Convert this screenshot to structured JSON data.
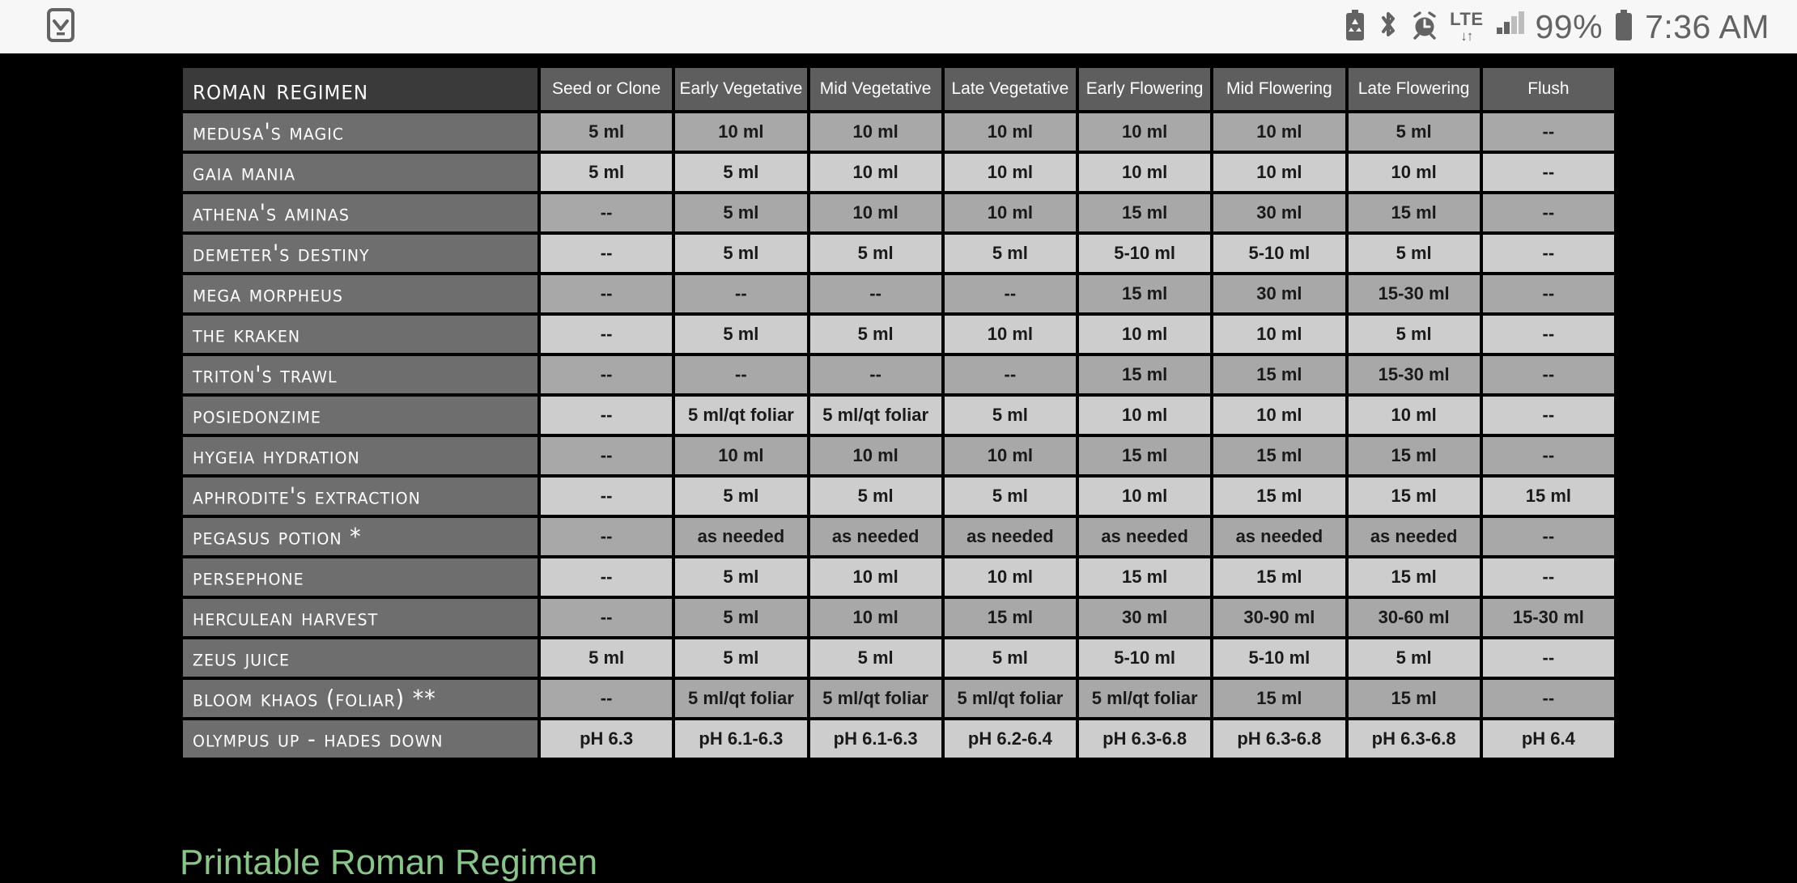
{
  "status_bar": {
    "left_icons": [
      {
        "name": "notification-checklist-icon",
        "glyph": "checklist"
      }
    ],
    "right_icons": [
      {
        "name": "battery-saver-icon",
        "glyph": "battery-saver"
      },
      {
        "name": "bluetooth-icon",
        "glyph": "bluetooth"
      },
      {
        "name": "alarm-clock-icon",
        "glyph": "alarm"
      },
      {
        "name": "lte-data-icon",
        "glyph": "lte"
      },
      {
        "name": "cellular-signal-icon",
        "glyph": "signal"
      }
    ],
    "lte_label": "LTE",
    "lte_arrows": "↓↑",
    "battery_percent": "99%",
    "time": "7:36 AM"
  },
  "colors": {
    "status_bar_bg": "#f7f7f7",
    "status_icon": "#636363",
    "page_bg": "#000000",
    "title_cell_bg": "#3a3a3a",
    "col_header_bg": "#5e5e5e",
    "row_label_bg": "#6e6e6e",
    "row_shade_dark": "#a8a8a8",
    "row_shade_light": "#cdcdcd",
    "cell_text": "#1a1a1a",
    "header_text": "#ffffff",
    "link_green": "#8bc48b"
  },
  "table": {
    "title": "Roman Regimen",
    "columns": [
      "Seed or Clone",
      "Early Vegetative",
      "Mid Vegetative",
      "Late Vegetative",
      "Early Flowering",
      "Mid Flowering",
      "Late Flowering",
      "Flush"
    ],
    "rows": [
      {
        "label": "Medusa's Magic",
        "shade": "dark",
        "values": [
          "5 ml",
          "10 ml",
          "10 ml",
          "10 ml",
          "10 ml",
          "10 ml",
          "5 ml",
          "--"
        ]
      },
      {
        "label": "Gaia Mania",
        "shade": "light",
        "values": [
          "5 ml",
          "5 ml",
          "10 ml",
          "10 ml",
          "10 ml",
          "10 ml",
          "10 ml",
          "--"
        ]
      },
      {
        "label": "Athena's Aminas",
        "shade": "dark",
        "values": [
          "--",
          "5 ml",
          "10 ml",
          "10 ml",
          "15 ml",
          "30 ml",
          "15 ml",
          "--"
        ]
      },
      {
        "label": "Demeter's Destiny",
        "shade": "light",
        "values": [
          "--",
          "5 ml",
          "5 ml",
          "5 ml",
          "5-10 ml",
          "5-10 ml",
          "5 ml",
          "--"
        ]
      },
      {
        "label": "Mega Morpheus",
        "shade": "dark",
        "values": [
          "--",
          "--",
          "--",
          "--",
          "15 ml",
          "30 ml",
          "15-30 ml",
          "--"
        ]
      },
      {
        "label": "The Kraken",
        "shade": "light",
        "values": [
          "--",
          "5 ml",
          "5 ml",
          "10 ml",
          "10 ml",
          "10 ml",
          "5 ml",
          "--"
        ]
      },
      {
        "label": "Triton's Trawl",
        "shade": "dark",
        "values": [
          "--",
          "--",
          "--",
          "--",
          "15 ml",
          "15 ml",
          "15-30 ml",
          "--"
        ]
      },
      {
        "label": "Posiedonzime",
        "shade": "light",
        "values": [
          "--",
          "5 ml/qt foliar",
          "5 ml/qt foliar",
          "5 ml",
          "10 ml",
          "10 ml",
          "10 ml",
          "--"
        ]
      },
      {
        "label": "Hygeia Hydration",
        "shade": "dark",
        "values": [
          "--",
          "10 ml",
          "10 ml",
          "10 ml",
          "15 ml",
          "15 ml",
          "15 ml",
          "--"
        ]
      },
      {
        "label": "Aphrodite's Extraction",
        "shade": "light",
        "values": [
          "--",
          "5 ml",
          "5 ml",
          "5 ml",
          "10 ml",
          "15 ml",
          "15 ml",
          "15 ml"
        ]
      },
      {
        "label": "Pegasus Potion *",
        "shade": "dark",
        "values": [
          "--",
          "as needed",
          "as needed",
          "as needed",
          "as needed",
          "as needed",
          "as needed",
          "--"
        ]
      },
      {
        "label": "Persephone",
        "shade": "light",
        "values": [
          "--",
          "5 ml",
          "10 ml",
          "10 ml",
          "15 ml",
          "15 ml",
          "15 ml",
          "--"
        ]
      },
      {
        "label": "Herculean Harvest",
        "shade": "dark",
        "values": [
          "--",
          "5 ml",
          "10 ml",
          "15 ml",
          "30 ml",
          "30-90 ml",
          "30-60 ml",
          "15-30 ml"
        ]
      },
      {
        "label": "Zeus Juice",
        "shade": "light",
        "values": [
          "5 ml",
          "5 ml",
          "5 ml",
          "5 ml",
          "5-10 ml",
          "5-10 ml",
          "5 ml",
          "--"
        ]
      },
      {
        "label": "Bloom Khaos (Foliar) **",
        "shade": "dark",
        "values": [
          "--",
          "5 ml/qt foliar",
          "5 ml/qt foliar",
          "5 ml/qt foliar",
          "5 ml/qt foliar",
          "15 ml",
          "15 ml",
          "--"
        ]
      },
      {
        "label": "Olympus Up - Hades Down",
        "shade": "light",
        "values": [
          "pH 6.3",
          "pH 6.1-6.3",
          "pH 6.1-6.3",
          "pH 6.2-6.4",
          "pH 6.3-6.8",
          "pH 6.3-6.8",
          "pH 6.3-6.8",
          "pH 6.4"
        ]
      }
    ]
  },
  "footer": {
    "printable_link": "Printable Roman Regimen"
  }
}
